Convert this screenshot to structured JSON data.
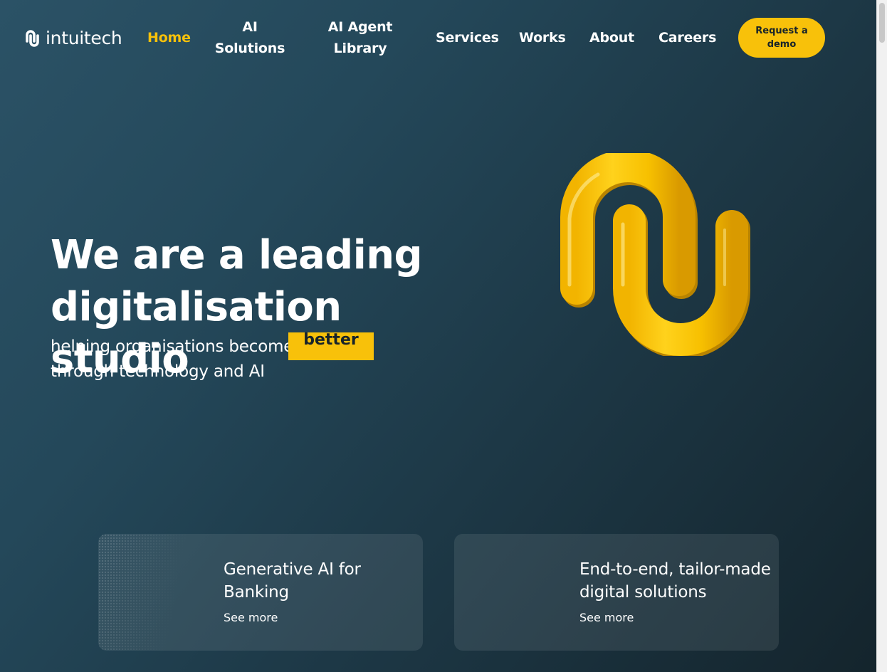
{
  "brand": {
    "name": "intuitech",
    "icon": "intuitech-logo-icon",
    "accent_color": "#f8c10a"
  },
  "nav": {
    "items": [
      {
        "label": "Home",
        "active": true
      },
      {
        "label": "AI Solutions",
        "line1": "AI",
        "line2": "Solutions"
      },
      {
        "label": "AI Agent Library",
        "line1": "AI Agent",
        "line2": "Library"
      },
      {
        "label": "Services"
      },
      {
        "label": "Works"
      },
      {
        "label": "About"
      },
      {
        "label": "Careers"
      }
    ],
    "cta_label": "Request a demo"
  },
  "hero": {
    "title": "We are a leading digitalisation studio",
    "subtitle_before": "helping organisations become",
    "highlight_word": "better",
    "subtitle_after": "through technology and AI",
    "graphic": "intuitech-3d-mark-icon"
  },
  "cards": [
    {
      "title": "Generative AI for Banking",
      "link": "See more"
    },
    {
      "title": "End-to-end, tailor-made digital solutions",
      "link": "See more"
    }
  ],
  "colors": {
    "accent": "#f8c10a",
    "background_dark": "#14242c",
    "background_light": "#2b5266"
  }
}
